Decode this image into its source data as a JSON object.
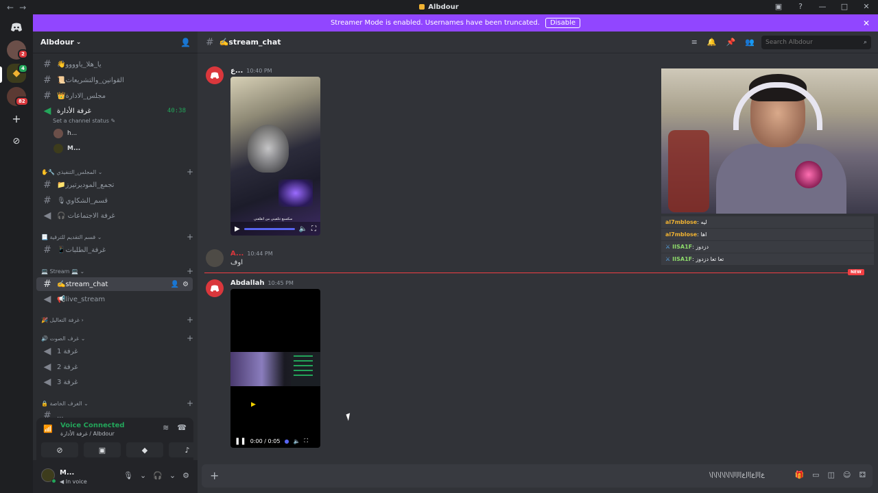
{
  "titlebar": {
    "title": "Albdour",
    "back": "←",
    "forward": "→",
    "icons": {
      "screen": "▣",
      "help": "?",
      "min": "—",
      "max": "□",
      "close": "✕"
    }
  },
  "rail": {
    "home_icon": "discord-icon",
    "server1_badge": "2",
    "server2_badge": "4",
    "server3_badge": "82",
    "add": "+",
    "explore": "⊘"
  },
  "banner": {
    "text": "Streamer Mode is enabled. Usernames have been truncated.",
    "button": "Disable",
    "close": "✕"
  },
  "sidebar": {
    "guild_name": "Albdour",
    "channels": [
      {
        "label": "👋يا_هلا_ياوووو"
      },
      {
        "label": "📜القوانين_والتشريعات"
      },
      {
        "label": "👑مجلس_الادارة"
      },
      {
        "label": "غرفة الأدارة",
        "timer": "40:38",
        "status": "Set a channel status"
      }
    ],
    "voice_users": [
      "h...",
      "M..."
    ],
    "categories": [
      {
        "label": "✋🔧 المجلس_التنفيذي ⌄"
      },
      {
        "label": "📃 قسم التقديم للترقية ⌄"
      },
      {
        "label": "💻 Stream 💻 ⌄"
      },
      {
        "label": "🎉 غرفة التعاليل ›"
      },
      {
        "label": "🔊 غرف الصوت ⌄"
      },
      {
        "label": "🔒 الغرف الخاصة ⌄"
      }
    ],
    "channels2": [
      {
        "label": "📁تجمع_الموديرتيرز"
      },
      {
        "label": "🎙قسم_الشكاوي"
      },
      {
        "label": "🎧 غرفة الاجتماعات"
      },
      {
        "label": "📱غرفة_الطلبات"
      },
      {
        "label": "✍️stream_chat"
      },
      {
        "label": "📢live_stream"
      },
      {
        "label": "غرفة 1"
      },
      {
        "label": "غرفة 2"
      },
      {
        "label": "غرفة 3"
      },
      {
        "label": "..."
      }
    ]
  },
  "voice_panel": {
    "title": "Voice Connected",
    "subtitle": "غرفة الأدارة / Albdour"
  },
  "user_panel": {
    "name": "M...",
    "status": "In voice"
  },
  "channel": {
    "name": "✍️stream_chat",
    "search_placeholder": "Search Albdour"
  },
  "messages": [
    {
      "author": "ع...",
      "time": "10:40 PM"
    },
    {
      "author": "A...",
      "time": "10:44 PM",
      "text": "اوف"
    },
    {
      "author": "Abdallah",
      "time": "10:45 PM",
      "video_time": "0:00 / 0:05"
    }
  ],
  "video1_overlay": "سكسبع تتلفيني من اتقلفني",
  "new_tag": "NEW",
  "twitch_chat": [
    {
      "name": "al7mblose",
      "text": "ليه"
    },
    {
      "name": "al7mblose",
      "text": "اها"
    },
    {
      "name": "IISA1F",
      "text": "دزدوز"
    },
    {
      "name": "IISA1F",
      "text": "تعا تعا دزدوز"
    }
  ],
  "composer": {
    "draft": "ع|ا|ع|ا|ع|ا|ا|\\|\\|\\|\\|\\|\\"
  }
}
